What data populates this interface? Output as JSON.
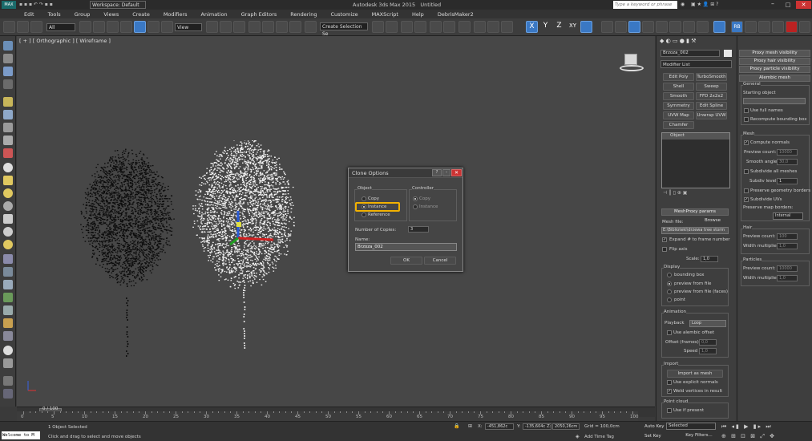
{
  "app": {
    "title": "Autodesk 3ds Max 2015",
    "document": "Untitled",
    "workspace": "Workspace: Default",
    "search_placeholder": "Type a keyword or phrase"
  },
  "menu": [
    "Edit",
    "Tools",
    "Group",
    "Views",
    "Create",
    "Modifiers",
    "Animation",
    "Graph Editors",
    "Rendering",
    "Customize",
    "MAXScript",
    "Help",
    "DebrisMaker2"
  ],
  "toolbar": {
    "selection_filter": "All",
    "view": "View",
    "selection_set": "Create Selection Se",
    "axis_x": "X",
    "axis_y": "Y",
    "axis_z": "Z",
    "axis_xy": "XY"
  },
  "viewport": {
    "label": "[ + ] [ Orthographic ] [ Wireframe ]"
  },
  "dialog": {
    "title": "Clone Options",
    "object_group": "Object",
    "copy": "Copy",
    "instance": "Instance",
    "reference": "Reference",
    "controller_group": "Controller",
    "ctrl_copy": "Copy",
    "ctrl_instance": "Instance",
    "copies_label": "Number of Copies:",
    "copies_value": "3",
    "name_label": "Name:",
    "name_value": "Brzoza_002",
    "ok": "OK",
    "cancel": "Cancel"
  },
  "command_panel": {
    "object_name": "Brzoza_002",
    "modifier_list": "Modifier List",
    "modifiers": [
      "Edit Poly",
      "TurboSmooth",
      "Shell",
      "Sweep",
      "Smooth",
      "FFD 2x2x2",
      "Symmetry",
      "Edit Spline",
      "UVW Map",
      "Unwrap UVW",
      "Chamfer"
    ],
    "stack_item": "Object",
    "meshproxy_title": "MeshProxy params",
    "mesh_file": "Mesh file:",
    "browse": "Browse",
    "file_path": "E:\\Biblioteki\\drzewa tree storm",
    "expand": "Expand # to frame number",
    "flip_axis": "Flip axis",
    "scale_label": "Scale:",
    "scale_value": "1,0",
    "display": "Display",
    "bounding_box": "bounding box",
    "preview_from_file": "preview from file",
    "preview_faces": "preview from file (faces)",
    "point": "point",
    "animation": "Animation",
    "playback": "Playback",
    "loop": "Loop",
    "use_alembic_offset": "Use alembic offset",
    "offset_frames": "Offset (frames)",
    "offset_value": "0,0",
    "speed": "Speed",
    "speed_value": "1,0",
    "import": "Import",
    "import_as_mesh": "Import as mesh",
    "use_explicit_normals": "Use explicit normals",
    "weld_vertices": "Weld vertices in result",
    "point_cloud": "Point cloud",
    "use_if_present": "Use if present"
  },
  "side_panel": {
    "proxy_mesh_visibility": "Proxy mesh visibility",
    "proxy_hair_visibility": "Proxy hair visibility",
    "proxy_particle_visibility": "Proxy particle visibility",
    "alembic_mesh": "Alembic mesh",
    "general": "General",
    "starting_object": "Starting object",
    "use_full_names": "Use full names",
    "recompute_bbox": "Recompute bounding box",
    "mesh": "Mesh",
    "compute_normals": "Compute normals",
    "preview_count": "Preview count:",
    "preview_count_value": "10000",
    "smooth_angle": "Smooth angle:",
    "smooth_angle_value": "30,0",
    "subdivide_all": "Subdivide all meshes",
    "subdiv_level": "Subdiv level:",
    "subdiv_level_value": "1",
    "preserve_geometry": "Preserve geometry borders",
    "subdivide_uvs": "Subdivide UVs",
    "preserve_map": "Preserve map borders:",
    "internal": "Internal",
    "hair": "Hair",
    "hair_preview_value": "100",
    "width_multiplier": "Width multiplier:",
    "width_value": "1,0",
    "particles": "Particles",
    "part_preview_value": "10000",
    "part_width_value": "1,0"
  },
  "timeline": {
    "position": "0 / 100",
    "ticks": [
      "0",
      "5",
      "10",
      "15",
      "20",
      "25",
      "30",
      "35",
      "40",
      "45",
      "50",
      "55",
      "60",
      "65",
      "70",
      "75",
      "80",
      "85",
      "90",
      "95",
      "100"
    ]
  },
  "status": {
    "welcome": "Welcome to M",
    "selected": "1 Object Selected",
    "prompt": "Click and drag to select and move objects",
    "x_value": "-451,862c",
    "y_value": "-135,604c",
    "z_value": "2050,26cm",
    "grid": "Grid = 100,0cm",
    "add_time_tag": "Add Time Tag",
    "auto_key": "Auto Key",
    "set_key": "Set Key",
    "selected_combo": "Selected",
    "key_filters": "Key Filters..."
  }
}
